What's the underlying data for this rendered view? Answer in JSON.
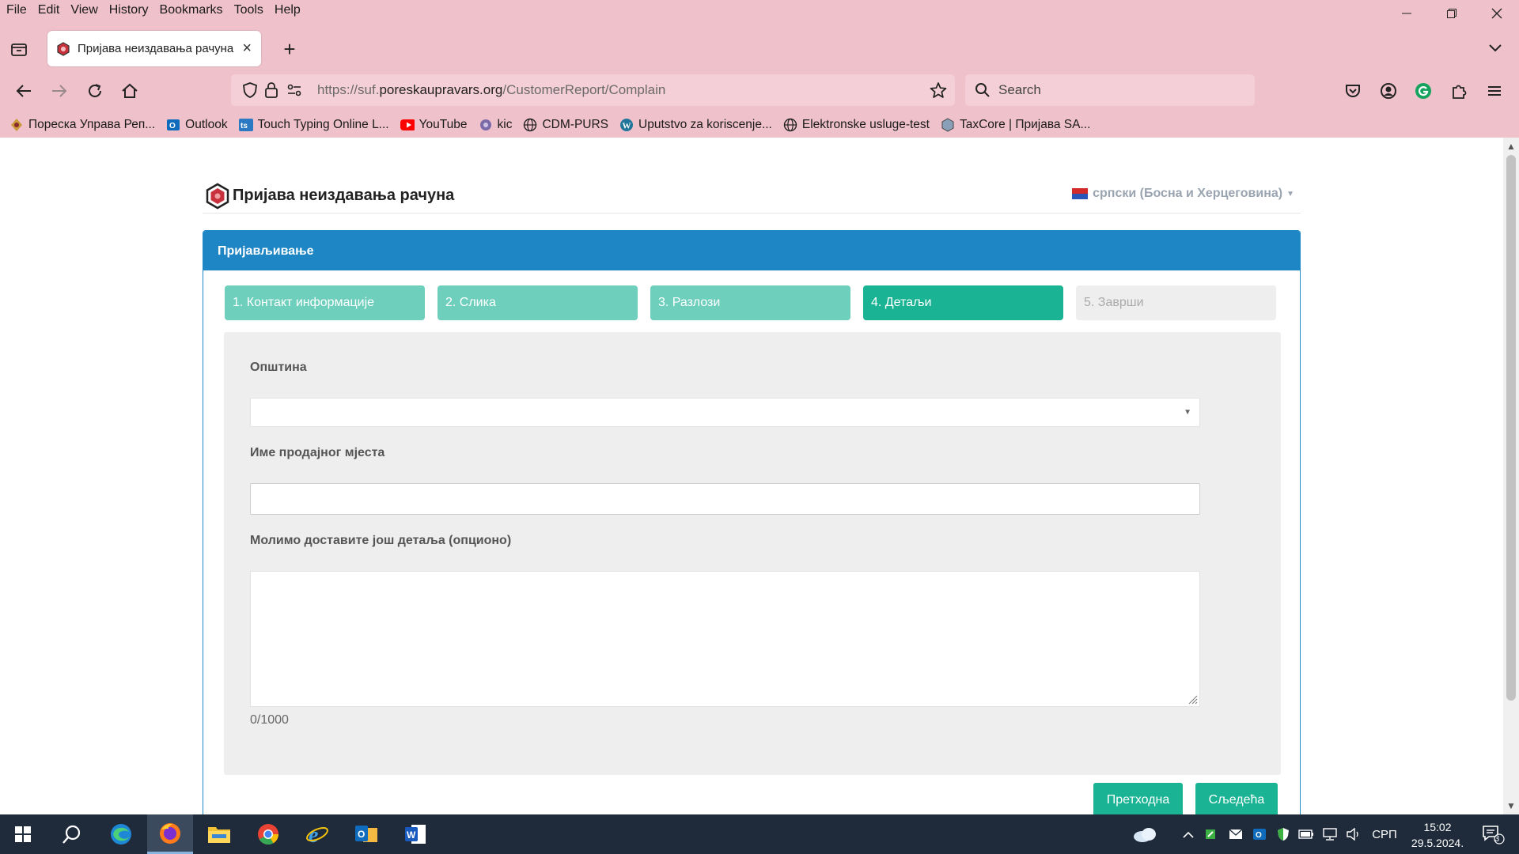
{
  "menubar": {
    "items": [
      "File",
      "Edit",
      "View",
      "History",
      "Bookmarks",
      "Tools",
      "Help"
    ]
  },
  "tab": {
    "title": "Пријава неиздавања рачуна"
  },
  "navbar": {
    "url_prefix": "https://suf.",
    "url_domain": "poreskaupravars.org",
    "url_path": "/CustomerReport/Complain",
    "search_placeholder": "Search"
  },
  "bookmarks": [
    {
      "label": "Пореска Управа Реп...",
      "icon": "tax-admin-icon"
    },
    {
      "label": "Outlook",
      "icon": "outlook-icon"
    },
    {
      "label": "Touch Typing Online L...",
      "icon": "typing-icon"
    },
    {
      "label": "YouTube",
      "icon": "youtube-icon"
    },
    {
      "label": "kic",
      "icon": "kic-icon"
    },
    {
      "label": "CDM-PURS",
      "icon": "globe-icon"
    },
    {
      "label": "Uputstvo za koriscenje...",
      "icon": "wordpress-icon"
    },
    {
      "label": "Elektronske usluge-test",
      "icon": "globe-icon"
    },
    {
      "label": "TaxCore | Пријава SA...",
      "icon": "shield-icon"
    }
  ],
  "site": {
    "title": "Пријава неиздавања рачуна",
    "language": "српски (Босна и Херцеговина)"
  },
  "panel": {
    "heading": "Пријављивање",
    "steps": [
      {
        "label": "1. Контакт информације",
        "state": "done"
      },
      {
        "label": "2. Слика",
        "state": "done"
      },
      {
        "label": "3. Разлози",
        "state": "done"
      },
      {
        "label": "4. Детаљи",
        "state": "active"
      },
      {
        "label": "5. Заврши",
        "state": "disabled"
      }
    ]
  },
  "form": {
    "municipality_label": "Општина",
    "municipality_value": "",
    "store_name_label": "Име продајног мјеста",
    "store_name_value": "",
    "details_label": "Молимо доставите још детаља (опционо)",
    "details_value": "",
    "counter": "0/1000"
  },
  "buttons": {
    "previous": "Претходна",
    "next": "Сљедећа"
  },
  "taskbar": {
    "language": "СРП",
    "time": "15:02",
    "date": "29.5.2024.",
    "notifications": "3"
  },
  "colors": {
    "browser_chrome": "#efc1cb",
    "panel_header": "#1f86c6",
    "step_done": "#6ecfbd",
    "step_active": "#1ab394",
    "button": "#1ab394",
    "taskbar": "#1f2b3a"
  }
}
